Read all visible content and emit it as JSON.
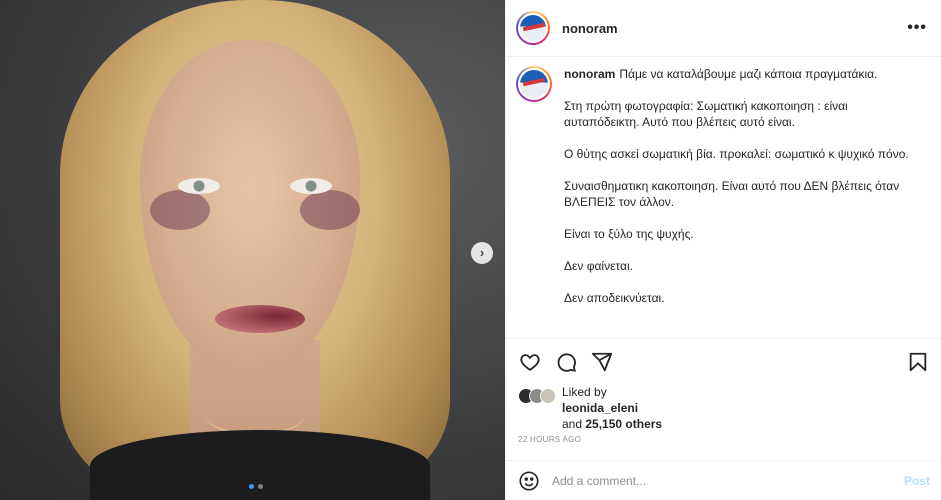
{
  "post": {
    "username": "nonoram",
    "more_icon": "more-horizontal-icon",
    "carousel": {
      "total": 2,
      "current": 1
    }
  },
  "caption": {
    "username": "nonoram",
    "paragraphs": [
      "Πάμε να καταλάβουμε μαζι κάποια πραγματάκια.",
      "Στη πρώτη φωτογραφία: Σωματική κακοποιηση : είναι αυταπόδεικτη. Αυτό που βλέπεις αυτό είναι.",
      "Ο θύτης ασκεί σωματική βία. προκαλεί: σωματικό κ ψυχικό πόνο.",
      "Συναισθηματικη κακοποιηση. Είναι αυτό που ΔΕΝ βλέπεις όταν ΒΛΕΠΕΙΣ τον άλλον.",
      "Είναι το ξύλο της ψυχής.",
      "Δεν φαίνεται.",
      "Δεν αποδεικνύεται."
    ]
  },
  "actions": {
    "like_icon": "heart-icon",
    "comment_icon": "comment-icon",
    "share_icon": "share-icon",
    "save_icon": "bookmark-icon"
  },
  "likes": {
    "prefix": "Liked by",
    "liker": "leonida_eleni",
    "and": "and",
    "others": "25,150 others"
  },
  "timestamp": "22 HOURS AGO",
  "comment": {
    "placeholder": "Add a comment...",
    "post_label": "Post",
    "emoji_icon": "emoji-icon"
  },
  "colors": {
    "accent": "#3897f0",
    "post_disabled": "#b2dffc",
    "muted": "#8e8e8e"
  }
}
